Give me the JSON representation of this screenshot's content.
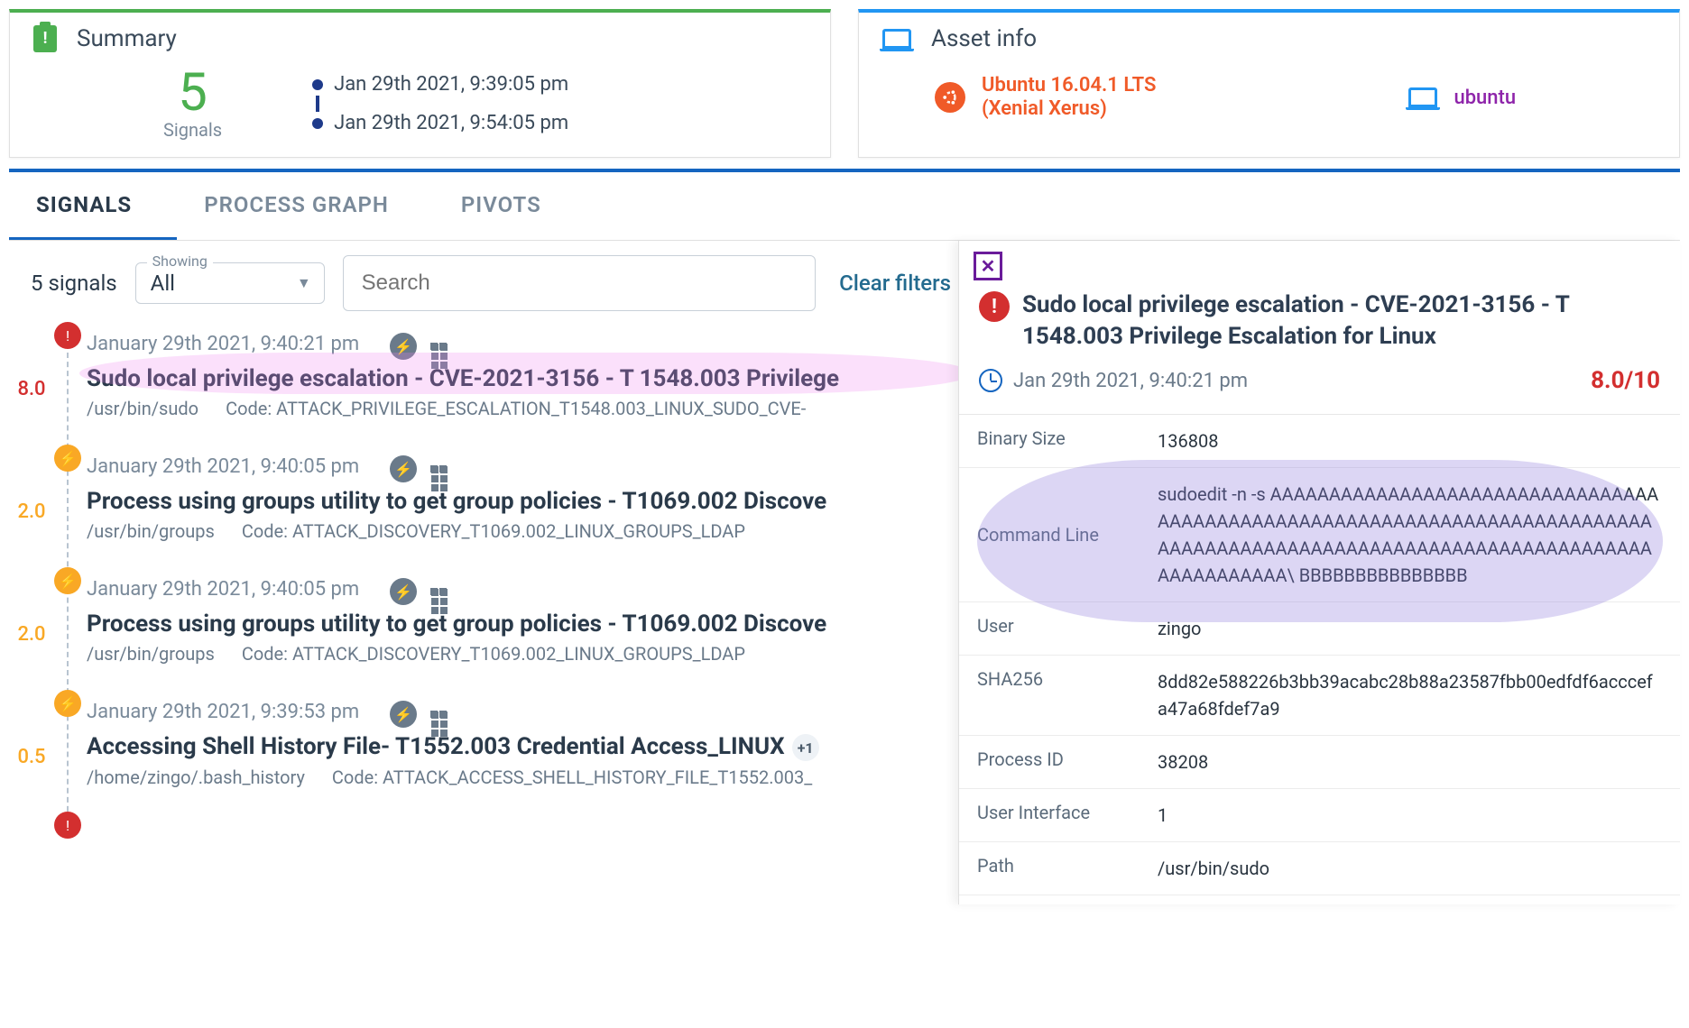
{
  "summary": {
    "title": "Summary",
    "count": "5",
    "count_label": "Signals",
    "time_start": "Jan 29th 2021, 9:39:05 pm",
    "time_end": "Jan 29th 2021, 9:54:05 pm"
  },
  "asset": {
    "title": "Asset info",
    "os_line1": "Ubuntu 16.04.1 LTS",
    "os_line2": "(Xenial Xerus)",
    "hostname": "ubuntu"
  },
  "tabs": {
    "signals": "SIGNALS",
    "process_graph": "PROCESS GRAPH",
    "pivots": "PIVOTS"
  },
  "filter": {
    "count_label": "5 signals",
    "showing_label": "Showing",
    "showing_value": "All",
    "search_placeholder": "Search",
    "clear": "Clear filters"
  },
  "signals": [
    {
      "score": "8.0",
      "score_class": "red",
      "dot_class": "red",
      "dot_glyph": "!",
      "date": "January 29th 2021, 9:40:21 pm",
      "title": "Sudo local privilege escalation - CVE-2021-3156 - T 1548.003 Privilege",
      "path": "/usr/bin/sudo",
      "code": "Code: ATTACK_PRIVILEGE_ESCALATION_T1548.003_LINUX_SUDO_CVE-",
      "badge": ""
    },
    {
      "score": "2.0",
      "score_class": "amber",
      "dot_class": "amber",
      "dot_glyph": "⚡",
      "date": "January 29th 2021, 9:40:05 pm",
      "title": "Process using groups utility to get group policies - T1069.002 Discove",
      "path": "/usr/bin/groups",
      "code": "Code: ATTACK_DISCOVERY_T1069.002_LINUX_GROUPS_LDAP",
      "badge": ""
    },
    {
      "score": "2.0",
      "score_class": "amber",
      "dot_class": "amber",
      "dot_glyph": "⚡",
      "date": "January 29th 2021, 9:40:05 pm",
      "title": "Process using groups utility to get group policies - T1069.002 Discove",
      "path": "/usr/bin/groups",
      "code": "Code: ATTACK_DISCOVERY_T1069.002_LINUX_GROUPS_LDAP",
      "badge": ""
    },
    {
      "score": "0.5",
      "score_class": "amber",
      "dot_class": "amber",
      "dot_glyph": "⚡",
      "date": "January 29th 2021, 9:39:53 pm",
      "title": "Accessing Shell History File- T1552.003 Credential Access_LINUX",
      "path": "/home/zingo/.bash_history",
      "code": "Code: ATTACK_ACCESS_SHELL_HISTORY_FILE_T1552.003_",
      "badge": "+1"
    }
  ],
  "detail": {
    "title": "Sudo local privilege escalation - CVE-2021-3156 - T 1548.003 Privilege Escalation for Linux",
    "timestamp": "Jan 29th 2021, 9:40:21 pm",
    "score": "8.0/10",
    "rows": {
      "binary_size": {
        "k": "Binary Size",
        "v": "136808"
      },
      "command_line": {
        "k": "Command Line",
        "v": "sudoedit -n -s AAAAAAAAAAAAAAAAAAAAAAAAAAAAAAAAAAAAAAAAAAAAAAAAAAAAAAAAAAAAAAAAAAAAAAAAAAAAAAAAAAAAAAAAAAAAAAAAAAAAAAAAAAAAAAAAAAAAAAAAAAAAAAAA\\ BBBBBBBBBBBBBBB"
      },
      "user": {
        "k": "User",
        "v": "zingo"
      },
      "sha256": {
        "k": "SHA256",
        "v": "8dd82e588226b3bb39acabc28b88a23587fbb00edfdf6acccefa47a68fdef7a9"
      },
      "process_id": {
        "k": "Process ID",
        "v": "38208"
      },
      "user_interface": {
        "k": "User Interface",
        "v": "1"
      },
      "path": {
        "k": "Path",
        "v": "/usr/bin/sudo"
      }
    }
  }
}
